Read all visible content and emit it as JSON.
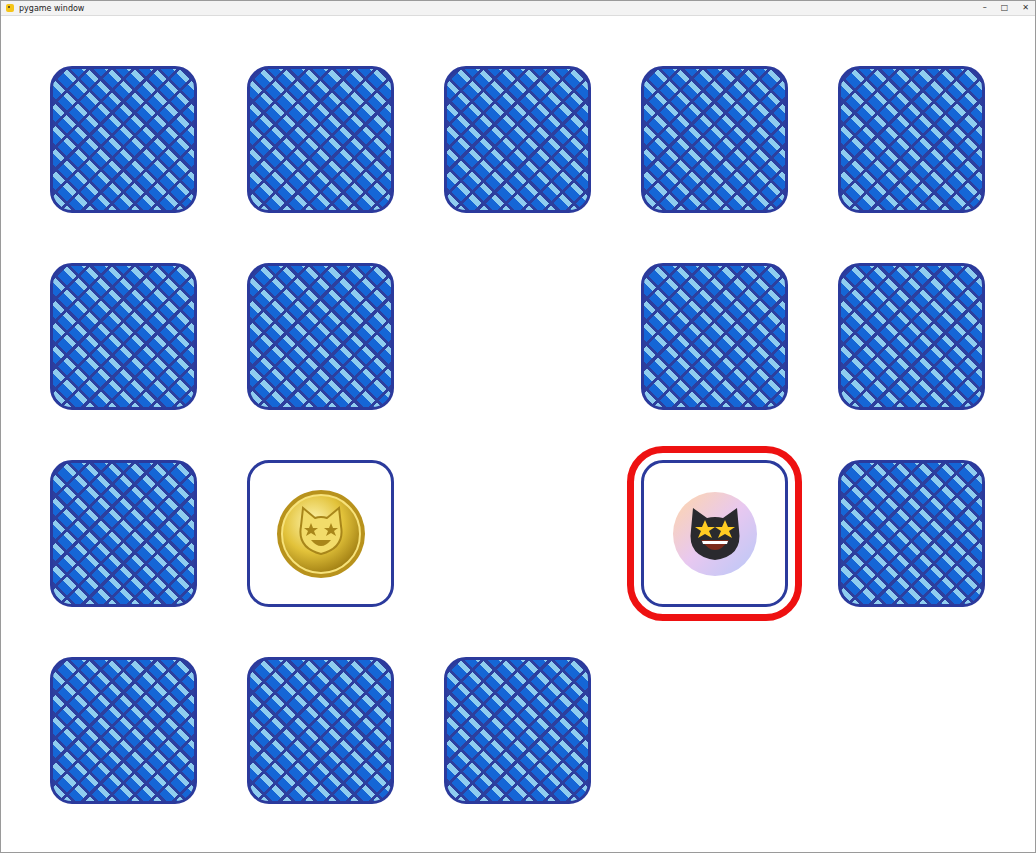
{
  "window": {
    "title": "pygame window",
    "controls": [
      "–",
      "□",
      "✕"
    ]
  },
  "cards": [
    {
      "kind": "back",
      "selected": false
    },
    {
      "kind": "back",
      "selected": false
    },
    {
      "kind": "back",
      "selected": false
    },
    {
      "kind": "back",
      "selected": false
    },
    {
      "kind": "back",
      "selected": false
    },
    {
      "kind": "back",
      "selected": false
    },
    {
      "kind": "back",
      "selected": false
    },
    {
      "kind": "empty",
      "selected": false
    },
    {
      "kind": "back",
      "selected": false
    },
    {
      "kind": "back",
      "selected": false
    },
    {
      "kind": "back",
      "selected": false
    },
    {
      "kind": "coin",
      "selected": false
    },
    {
      "kind": "empty",
      "selected": false
    },
    {
      "kind": "cat",
      "selected": true
    },
    {
      "kind": "back",
      "selected": false
    },
    {
      "kind": "back",
      "selected": false
    },
    {
      "kind": "back",
      "selected": false
    },
    {
      "kind": "back",
      "selected": false
    },
    {
      "kind": "empty",
      "selected": false
    },
    {
      "kind": "empty",
      "selected": false
    }
  ]
}
